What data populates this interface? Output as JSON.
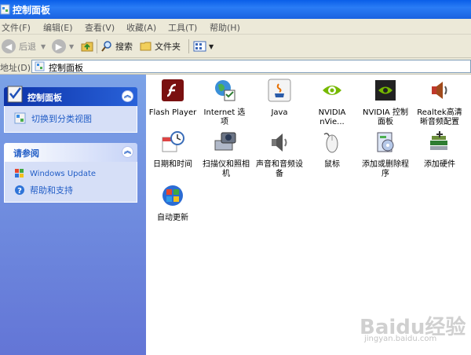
{
  "window": {
    "title": "控制面板"
  },
  "menu": [
    "文件(F)",
    "编辑(E)",
    "查看(V)",
    "收藏(A)",
    "工具(T)",
    "帮助(H)"
  ],
  "toolbar": {
    "back": "后退",
    "search": "搜索",
    "folders": "文件夹"
  },
  "address": {
    "label": "地址(D)",
    "value": "控制面板"
  },
  "sidebar": {
    "panel1": {
      "title": "控制面板",
      "link": "切换到分类视图"
    },
    "panel2": {
      "title": "请参阅",
      "links": [
        "Windows Update",
        "帮助和支持"
      ]
    }
  },
  "items": [
    {
      "label": "Flash Player",
      "icon": "flash-icon"
    },
    {
      "label": "Internet 选项",
      "icon": "internet-options-icon"
    },
    {
      "label": "Java",
      "icon": "java-icon"
    },
    {
      "label": "NVIDIA nVie...",
      "icon": "nvidia-nview-icon"
    },
    {
      "label": "NVIDIA 控制面板",
      "icon": "nvidia-control-panel-icon"
    },
    {
      "label": "Realtek高清晰音频配置",
      "icon": "realtek-audio-icon"
    },
    {
      "label": "日期和时间",
      "icon": "date-time-icon"
    },
    {
      "label": "扫描仪和照相机",
      "icon": "scanner-camera-icon"
    },
    {
      "label": "声音和音频设备",
      "icon": "sound-icon"
    },
    {
      "label": "鼠标",
      "icon": "mouse-icon"
    },
    {
      "label": "添加或删除程序",
      "icon": "add-remove-programs-icon"
    },
    {
      "label": "添加硬件",
      "icon": "add-hardware-icon"
    },
    {
      "label": "自动更新",
      "icon": "automatic-updates-icon"
    }
  ],
  "watermark": {
    "brand": "Baidu经验",
    "url": "jingyan.baidu.com"
  }
}
